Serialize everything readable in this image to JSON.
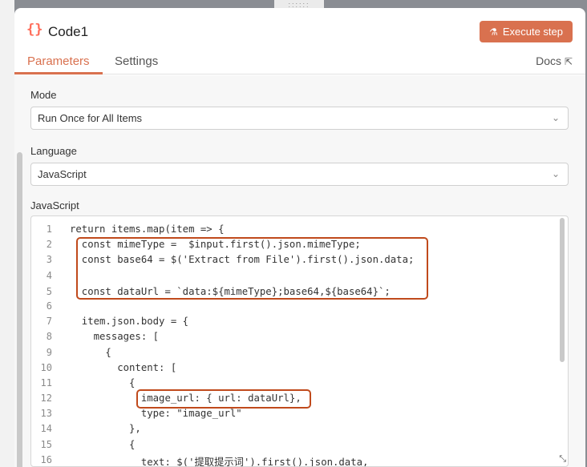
{
  "window": {
    "drag_handle": "::::::"
  },
  "header": {
    "icon": "{}",
    "title": "Code1",
    "execute_label": "Execute step"
  },
  "tabs": [
    {
      "label": "Parameters",
      "active": true
    },
    {
      "label": "Settings",
      "active": false
    }
  ],
  "docs": {
    "label": "Docs",
    "icon": "external-link-icon"
  },
  "mode": {
    "label": "Mode",
    "value": "Run Once for All Items"
  },
  "language": {
    "label": "Language",
    "value": "JavaScript"
  },
  "editor": {
    "label": "JavaScript",
    "line_numbers": [
      "1",
      "2",
      "3",
      "4",
      "5",
      "6",
      "7",
      "8",
      "9",
      "10",
      "11",
      "12",
      "13",
      "14",
      "15",
      "16"
    ],
    "lines": [
      "return items.map(item => {",
      "  const mimeType =  $input.first().json.mimeType;",
      "  const base64 = $('Extract from File').first().json.data;",
      "",
      "  const dataUrl = `data:${mimeType};base64,${base64}`;",
      "",
      "  item.json.body = {",
      "    messages: [",
      "      {",
      "        content: [",
      "          {",
      "            image_url: { url: dataUrl},",
      "            type: \"image_url\"",
      "          },",
      "          {",
      "            text: $('提取提示词').first().json.data,"
    ]
  },
  "colors": {
    "accent": "#d9714f",
    "highlight": "#c04a1c"
  }
}
